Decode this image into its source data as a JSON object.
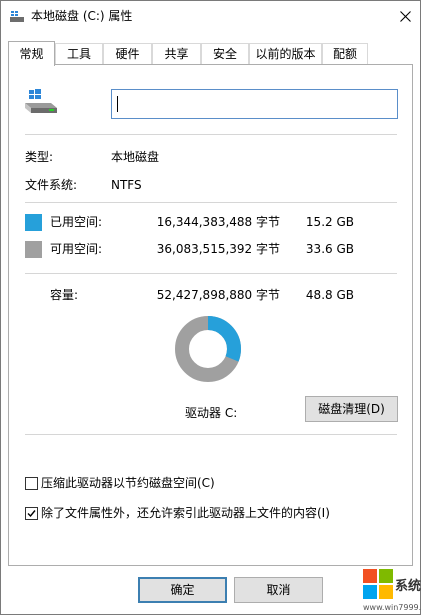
{
  "window": {
    "title": "本地磁盘 (C:) 属性",
    "icons": {
      "title": "drive-icon",
      "close": "close-icon"
    }
  },
  "tabs": [
    {
      "label": "常规",
      "active": true
    },
    {
      "label": "工具",
      "active": false
    },
    {
      "label": "硬件",
      "active": false
    },
    {
      "label": "共享",
      "active": false
    },
    {
      "label": "安全",
      "active": false
    },
    {
      "label": "以前的版本",
      "active": false
    },
    {
      "label": "配额",
      "active": false
    }
  ],
  "general": {
    "drive_name": "",
    "type_label": "类型:",
    "type_value": "本地磁盘",
    "fs_label": "文件系统:",
    "fs_value": "NTFS",
    "used": {
      "label": "已用空间:",
      "bytes": "16,344,383,488 字节",
      "size": "15.2 GB",
      "color": "#26a0da"
    },
    "free": {
      "label": "可用空间:",
      "bytes": "36,083,515,392 字节",
      "size": "33.6 GB",
      "color": "#a0a0a0"
    },
    "capacity": {
      "label": "容量:",
      "bytes": "52,427,898,880 字节",
      "size": "48.8 GB"
    },
    "used_fraction": 0.3118,
    "drive_caption": "驱动器 C:",
    "cleanup_button": "磁盘清理(D)",
    "compress_checkbox": {
      "label": "压缩此驱动器以节约磁盘空间(C)",
      "checked": false
    },
    "index_checkbox": {
      "label": "除了文件属性外，还允许索引此驱动器上文件的内容(I)",
      "checked": true
    }
  },
  "buttons": {
    "ok": "确定",
    "cancel": "取消"
  },
  "watermark": {
    "text": "系统粉",
    "url": "www.win7999.com",
    "colors": [
      "#f25022",
      "#7fba00",
      "#00a4ef",
      "#ffb900"
    ]
  }
}
